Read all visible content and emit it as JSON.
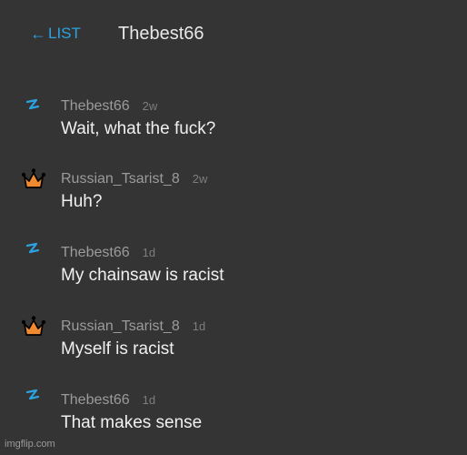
{
  "header": {
    "back_arrow": "←",
    "back_label": "LIST",
    "title": "Thebest66"
  },
  "messages": [
    {
      "user": "Thebest66",
      "time": "2w",
      "text": "Wait, what the fuck?",
      "icon": "lightning-icon"
    },
    {
      "user": "Russian_Tsarist_8",
      "time": "2w",
      "text": "Huh?",
      "icon": "crown-icon"
    },
    {
      "user": "Thebest66",
      "time": "1d",
      "text": "My chainsaw is racist",
      "icon": "lightning-icon"
    },
    {
      "user": "Russian_Tsarist_8",
      "time": "1d",
      "text": "Myself is racist",
      "icon": "crown-icon"
    },
    {
      "user": "Thebest66",
      "time": "1d",
      "text": "That makes sense",
      "icon": "lightning-icon"
    }
  ],
  "watermark": "imgflip.com",
  "colors": {
    "background": "#343434",
    "accent": "#2ba3e0",
    "crown": "#f08a30"
  }
}
